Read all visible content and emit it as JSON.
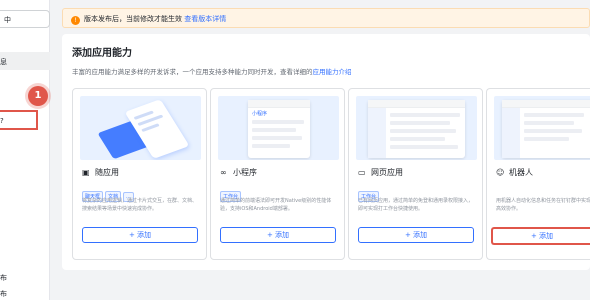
{
  "sidebar": {
    "top_label": "中",
    "items": [
      {
        "label": "息",
        "active": true
      },
      {
        "label": "?",
        "highlight": true
      },
      {
        "label": "布"
      },
      {
        "label": "布"
      }
    ],
    "badge": "1"
  },
  "notice": {
    "text": "版本发布后，当前修改才能生效",
    "link": "查看版本详情"
  },
  "page": {
    "title": "添加应用能力",
    "subtitle": "丰富的应用能力满足多样的开发诉求，一个应用支持多种能力同时开发，查看详细的",
    "subtitle_link": "应用能力介绍"
  },
  "cards": [
    {
      "icon": "chat-card-icon",
      "title": "随应用",
      "tags": [
        "聊天框",
        "文档",
        "..."
      ],
      "desc": "将复杂的应用逻辑，通过卡片式交互，在群、文档、搜索结果等场景中快速完成协作。",
      "add_label": "+ 添加"
    },
    {
      "icon": "link-icon",
      "title": "小程序",
      "tags": [
        "工作台"
      ],
      "desc": "通过简单的前端语法即可开发Native级别的性能体验，支持iOS和Android端部署。",
      "add_label": "+ 添加",
      "mini_label": "小程序"
    },
    {
      "icon": "browser-icon",
      "title": "网页应用",
      "tags": [
        "工作台"
      ],
      "desc": "已有网页应用，通过简单的免登和通用录权限接入，即可实现打工作台快捷使用。",
      "add_label": "+ 添加"
    },
    {
      "icon": "robot-icon",
      "title": "机器人",
      "tags": [],
      "desc": "用机器人自动化信息和任务在钉钉群中实现高效协作。",
      "add_label": "+ 添加"
    }
  ],
  "colors": {
    "accent": "#3370ff",
    "highlight": "#e0564a",
    "notice_bg": "#fff4e5"
  }
}
